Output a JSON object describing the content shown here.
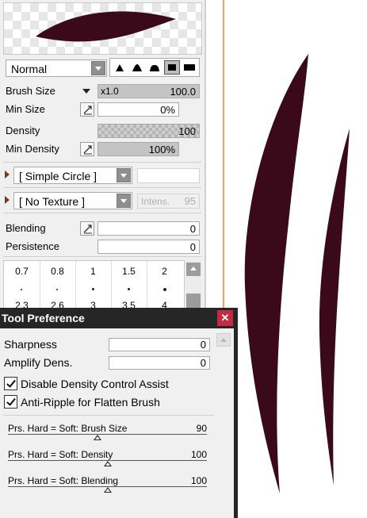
{
  "brush": {
    "color": "#3a0a1a",
    "blend_mode": "Normal",
    "shape_options": [
      "tapered-tip-1",
      "tapered-tip-2",
      "tapered-tip-3",
      "flat-square",
      "flat-rect"
    ],
    "shape_selected_index": 3
  },
  "params": {
    "brush_size_label": "Brush Size",
    "brush_size_multiplier": "x1.0",
    "brush_size_value": "100.0",
    "min_size_label": "Min Size",
    "min_size_value": "0%",
    "density_label": "Density",
    "density_value": "100",
    "min_density_label": "Min Density",
    "min_density_value": "100%"
  },
  "shape_select": {
    "value": "[ Simple Circle ]"
  },
  "texture_select": {
    "value": "[ No Texture ]",
    "intensity_placeholder": "Intens.",
    "intensity_value": "95"
  },
  "blending": {
    "blending_label": "Blending",
    "blending_value": "0",
    "persistence_label": "Persistence",
    "persistence_value": "0"
  },
  "size_grid": {
    "row1": [
      "0.7",
      "0.8",
      "1",
      "1.5",
      "2"
    ],
    "row3": [
      "2.3",
      "2.6",
      "3",
      "3.5",
      "4"
    ]
  },
  "dialog": {
    "title": "Tool Preference",
    "close_label": "✕",
    "sharpness_label": "Sharpness",
    "sharpness_value": "0",
    "amplify_label": "Amplify Dens.",
    "amplify_value": "0",
    "disable_density_label": "Disable Density Control Assist",
    "disable_density_checked": true,
    "anti_ripple_label": "Anti-Ripple for Flatten Brush",
    "anti_ripple_checked": true,
    "sliders": [
      {
        "label": "Prs. Hard = Soft: Brush Size",
        "value": "90",
        "level": 0.45
      },
      {
        "label": "Prs. Hard = Soft: Density",
        "value": "100",
        "level": 0.5
      },
      {
        "label": "Prs. Hard = Soft: Blending",
        "value": "100",
        "level": 0.5
      }
    ]
  },
  "icons": [
    "dropdown-arrow-icon",
    "pressure-icon",
    "expand-arrow-icon",
    "close-icon",
    "scroll-up-icon",
    "check-icon"
  ],
  "colors": {
    "canvas_border": "#f1a168",
    "dialog_titlebar": "#262626",
    "close_button": "#c42b43"
  }
}
